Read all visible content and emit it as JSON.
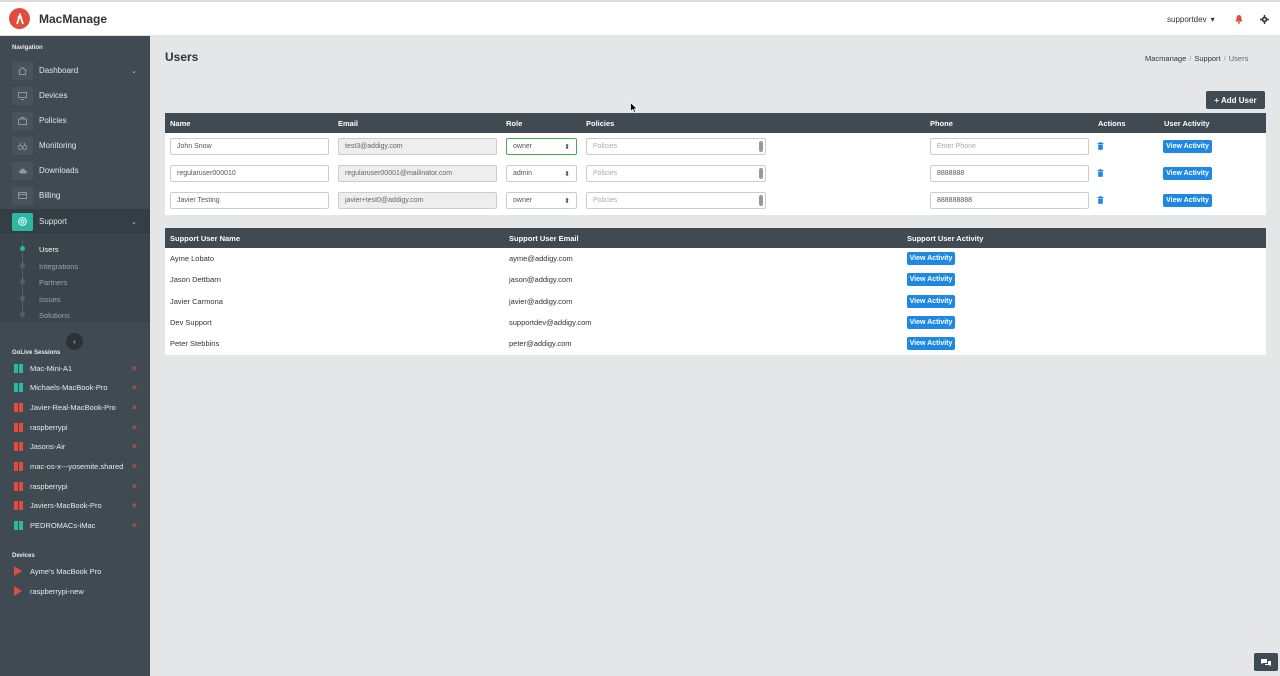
{
  "app": {
    "brand": "MacManage",
    "user": "supportdev",
    "user_caret": "▾"
  },
  "sidebar": {
    "nav_heading": "Navigation",
    "items": [
      {
        "label": "Dashboard",
        "icon": "home-icon",
        "chevron": "⌄"
      },
      {
        "label": "Devices",
        "icon": "monitor-icon"
      },
      {
        "label": "Policies",
        "icon": "briefcase-icon"
      },
      {
        "label": "Monitoring",
        "icon": "binoculars-icon"
      },
      {
        "label": "Downloads",
        "icon": "cloud-download-icon"
      },
      {
        "label": "Billing",
        "icon": "credit-card-icon"
      },
      {
        "label": "Support",
        "icon": "lifebuoy-icon",
        "chevron": "⌄",
        "active": true
      }
    ],
    "support_sub": [
      "Users",
      "Integrations",
      "Partners",
      "Issues",
      "Solutions"
    ],
    "golive_heading": "GoLive Sessions",
    "sessions": [
      {
        "label": "Mac-Mini-A1",
        "status": "online"
      },
      {
        "label": "Michaels-MacBook-Pro",
        "status": "online"
      },
      {
        "label": "Javier-Real-MacBook-Pro",
        "status": "offline"
      },
      {
        "label": "raspberrypi",
        "status": "offline"
      },
      {
        "label": "Jasons-Air",
        "status": "offline"
      },
      {
        "label": "mac-os-x---yosemite.shared",
        "status": "offline"
      },
      {
        "label": "raspberrypi",
        "status": "offline"
      },
      {
        "label": "Javiers-MacBook-Pro",
        "status": "offline"
      },
      {
        "label": "PEDROMACs-iMac",
        "status": "online"
      }
    ],
    "devices_heading": "Devices",
    "devices": [
      "Ayme's MacBook Pro",
      "raspberrypi-new"
    ],
    "close_glyph": "×",
    "collapse_glyph": "‹"
  },
  "page": {
    "title": "Users",
    "breadcrumb": [
      "Macmanage",
      "Support",
      "Users"
    ],
    "breadcrumb_sep": "/",
    "add_user_label": "+ Add User"
  },
  "users_table": {
    "headers": [
      "Name",
      "Email",
      "Role",
      "Policies",
      "Phone",
      "Actions",
      "User Activity"
    ],
    "rows": [
      {
        "name": "John Snow",
        "email": "test3@addigy.com",
        "role": "owner",
        "policies_placeholder": "Policies",
        "phone": "",
        "phone_placeholder": "Enter Phone",
        "activity": "View Activity"
      },
      {
        "name": "regularuser000010",
        "email": "regularuser00001@mailinator.com",
        "role": "admin",
        "policies_placeholder": "Policies",
        "phone": "8888888",
        "phone_placeholder": "Enter Phone",
        "activity": "View Activity"
      },
      {
        "name": "Javier Testing",
        "email": "javier+test0@addigy.com",
        "role": "owner",
        "policies_placeholder": "Policies",
        "phone": "888888888",
        "phone_placeholder": "Enter Phone",
        "activity": "View Activity"
      }
    ],
    "select_arrow": "⬍"
  },
  "support_table": {
    "headers": [
      "Support User Name",
      "Support User Email",
      "Support User Activity"
    ],
    "rows": [
      {
        "name": "Ayme Lobato",
        "email": "ayme@addigy.com",
        "activity": "View Activity"
      },
      {
        "name": "Jason Dettbarn",
        "email": "jason@addigy.com",
        "activity": "View Activity"
      },
      {
        "name": "Javier Carmona",
        "email": "javier@addigy.com",
        "activity": "View Activity"
      },
      {
        "name": "Dev Support",
        "email": "supportdev@addigy.com",
        "activity": "View Activity"
      },
      {
        "name": "Peter Stebbins",
        "email": "peter@addigy.com",
        "activity": "View Activity"
      }
    ]
  },
  "colors": {
    "accent": "#2cb8a3",
    "brand_red": "#e34c3c",
    "button_blue": "#1e88e5",
    "dark": "#3f4a52"
  }
}
